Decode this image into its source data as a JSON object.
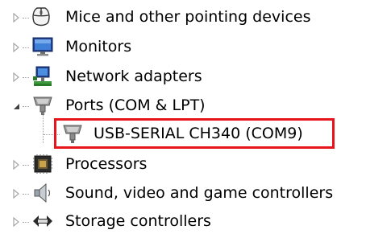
{
  "device_tree": {
    "items": [
      {
        "label": "Mice and other pointing devices",
        "icon": "mouse-icon",
        "expanded": false
      },
      {
        "label": "Monitors",
        "icon": "monitor-icon",
        "expanded": false
      },
      {
        "label": "Network adapters",
        "icon": "network-adapter-icon",
        "expanded": false
      },
      {
        "label": "Ports (COM & LPT)",
        "icon": "port-connector-icon",
        "expanded": true,
        "children": [
          {
            "label": "USB-SERIAL CH340 (COM9)",
            "icon": "port-connector-icon"
          }
        ]
      },
      {
        "label": "Processors",
        "icon": "processor-icon",
        "expanded": false
      },
      {
        "label": "Sound, video and game controllers",
        "icon": "speaker-icon",
        "expanded": false
      },
      {
        "label": "Storage controllers",
        "icon": "storage-controller-icon",
        "expanded": false
      }
    ]
  },
  "colors": {
    "highlight_border": "#e8141c",
    "tree_lines": "#a0a0a0"
  }
}
